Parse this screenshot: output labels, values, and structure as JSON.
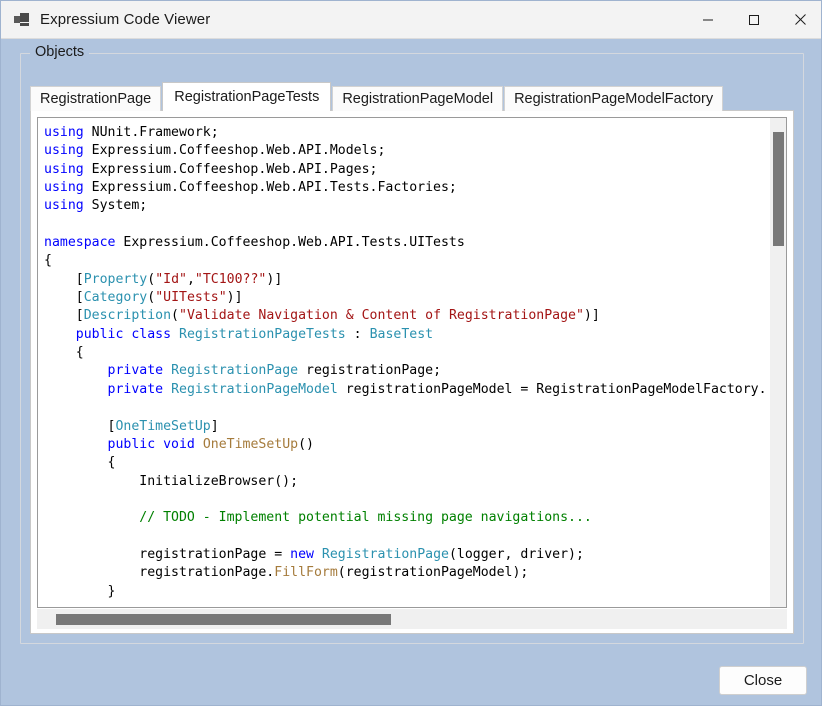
{
  "window": {
    "title": "Expressium Code Viewer",
    "icon": "app-window-icon",
    "controls": {
      "minimize": "minimize-icon",
      "maximize": "maximize-icon",
      "close": "close-icon"
    }
  },
  "groupbox": {
    "legend": "Objects"
  },
  "tabs": [
    {
      "label": "RegistrationPage",
      "selected": false
    },
    {
      "label": "RegistrationPageTests",
      "selected": true
    },
    {
      "label": "RegistrationPageModel",
      "selected": false
    },
    {
      "label": "RegistrationPageModelFactory",
      "selected": false
    }
  ],
  "editor": {
    "language": "csharp",
    "vertical_scroll_thumb_position": "top",
    "horizontal_scroll_thumb_position": "left",
    "lines": [
      [
        {
          "t": "using",
          "c": "kw"
        },
        {
          "t": " NUnit.Framework;",
          "c": "pln"
        }
      ],
      [
        {
          "t": "using",
          "c": "kw"
        },
        {
          "t": " Expressium.Coffeeshop.Web.API.Models;",
          "c": "pln"
        }
      ],
      [
        {
          "t": "using",
          "c": "kw"
        },
        {
          "t": " Expressium.Coffeeshop.Web.API.Pages;",
          "c": "pln"
        }
      ],
      [
        {
          "t": "using",
          "c": "kw"
        },
        {
          "t": " Expressium.Coffeeshop.Web.API.Tests.Factories;",
          "c": "pln"
        }
      ],
      [
        {
          "t": "using",
          "c": "kw"
        },
        {
          "t": " System;",
          "c": "pln"
        }
      ],
      [],
      [
        {
          "t": "namespace",
          "c": "kw"
        },
        {
          "t": " Expressium.Coffeeshop.Web.API.Tests.UITests",
          "c": "pln"
        }
      ],
      [
        {
          "t": "{",
          "c": "pln"
        }
      ],
      [
        {
          "t": "    [",
          "c": "pln"
        },
        {
          "t": "Property",
          "c": "typ"
        },
        {
          "t": "(",
          "c": "pln"
        },
        {
          "t": "\"Id\"",
          "c": "str"
        },
        {
          "t": ",",
          "c": "pln"
        },
        {
          "t": "\"TC100??\"",
          "c": "str"
        },
        {
          "t": ")]",
          "c": "pln"
        }
      ],
      [
        {
          "t": "    [",
          "c": "pln"
        },
        {
          "t": "Category",
          "c": "typ"
        },
        {
          "t": "(",
          "c": "pln"
        },
        {
          "t": "\"UITests\"",
          "c": "str"
        },
        {
          "t": ")]",
          "c": "pln"
        }
      ],
      [
        {
          "t": "    [",
          "c": "pln"
        },
        {
          "t": "Description",
          "c": "typ"
        },
        {
          "t": "(",
          "c": "pln"
        },
        {
          "t": "\"Validate Navigation & Content of RegistrationPage\"",
          "c": "str"
        },
        {
          "t": ")]",
          "c": "pln"
        }
      ],
      [
        {
          "t": "    ",
          "c": "pln"
        },
        {
          "t": "public class",
          "c": "kw"
        },
        {
          "t": " ",
          "c": "pln"
        },
        {
          "t": "RegistrationPageTests",
          "c": "typ"
        },
        {
          "t": " : ",
          "c": "pln"
        },
        {
          "t": "BaseTest",
          "c": "typ"
        }
      ],
      [
        {
          "t": "    {",
          "c": "pln"
        }
      ],
      [
        {
          "t": "        ",
          "c": "pln"
        },
        {
          "t": "private",
          "c": "kw"
        },
        {
          "t": " ",
          "c": "pln"
        },
        {
          "t": "RegistrationPage",
          "c": "typ"
        },
        {
          "t": " registrationPage;",
          "c": "pln"
        }
      ],
      [
        {
          "t": "        ",
          "c": "pln"
        },
        {
          "t": "private",
          "c": "kw"
        },
        {
          "t": " ",
          "c": "pln"
        },
        {
          "t": "RegistrationPageModel",
          "c": "typ"
        },
        {
          "t": " registrationPageModel = RegistrationPageModelFactory.",
          "c": "pln"
        }
      ],
      [],
      [
        {
          "t": "        [",
          "c": "pln"
        },
        {
          "t": "OneTimeSetUp",
          "c": "typ"
        },
        {
          "t": "]",
          "c": "pln"
        }
      ],
      [
        {
          "t": "        ",
          "c": "pln"
        },
        {
          "t": "public void",
          "c": "kw"
        },
        {
          "t": " ",
          "c": "pln"
        },
        {
          "t": "OneTimeSetUp",
          "c": "mth"
        },
        {
          "t": "()",
          "c": "pln"
        }
      ],
      [
        {
          "t": "        {",
          "c": "pln"
        }
      ],
      [
        {
          "t": "            InitializeBrowser();",
          "c": "pln"
        }
      ],
      [],
      [
        {
          "t": "            // TODO - Implement potential missing page navigations...",
          "c": "cmt"
        }
      ],
      [],
      [
        {
          "t": "            registrationPage = ",
          "c": "pln"
        },
        {
          "t": "new",
          "c": "kw"
        },
        {
          "t": " ",
          "c": "pln"
        },
        {
          "t": "RegistrationPage",
          "c": "typ"
        },
        {
          "t": "(logger, driver);",
          "c": "pln"
        }
      ],
      [
        {
          "t": "            registrationPage.",
          "c": "pln"
        },
        {
          "t": "FillForm",
          "c": "mth"
        },
        {
          "t": "(registrationPageModel);",
          "c": "pln"
        }
      ],
      [
        {
          "t": "        }",
          "c": "pln"
        }
      ]
    ]
  },
  "footer": {
    "close_label": "Close"
  },
  "colors": {
    "window_background": "#b0c4de",
    "titlebar_background": "#f3f3f3",
    "editor_background": "#ffffff",
    "keyword": "#0000ff",
    "type": "#2b91af",
    "string": "#a31515",
    "comment": "#008000",
    "method": "#a57b3c",
    "scrollbar_thumb": "#787878"
  }
}
